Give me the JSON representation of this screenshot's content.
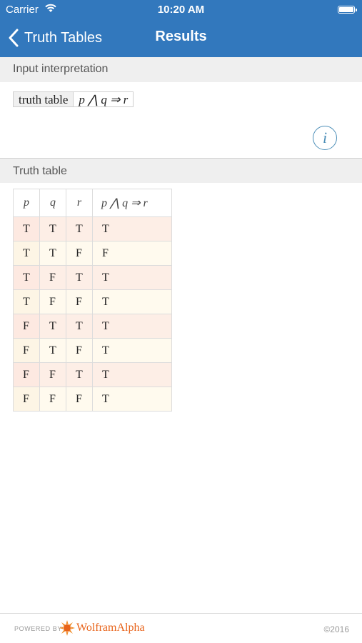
{
  "status": {
    "carrier": "Carrier",
    "time": "10:20 AM"
  },
  "nav": {
    "back_label": "Truth Tables",
    "title": "Results"
  },
  "input_section": {
    "header": "Input interpretation",
    "cell_label": "truth table",
    "cell_expression": "p ⋀ q ⇒ r",
    "info_symbol": "i"
  },
  "truth_table": {
    "header": "Truth table",
    "columns": [
      "p",
      "q",
      "r",
      "p ⋀ q ⇒ r"
    ],
    "rows": [
      [
        "T",
        "T",
        "T",
        "T"
      ],
      [
        "T",
        "T",
        "F",
        "F"
      ],
      [
        "T",
        "F",
        "T",
        "T"
      ],
      [
        "T",
        "F",
        "F",
        "T"
      ],
      [
        "F",
        "T",
        "T",
        "T"
      ],
      [
        "F",
        "T",
        "F",
        "T"
      ],
      [
        "F",
        "F",
        "T",
        "T"
      ],
      [
        "F",
        "F",
        "F",
        "T"
      ]
    ]
  },
  "footer": {
    "powered_by": "POWERED BY",
    "brand": "WolframAlpha",
    "copyright": "©2016"
  },
  "colors": {
    "nav_blue": "#3278bd",
    "brand_orange": "#e8631a",
    "info_blue": "#4d8fb8"
  },
  "icons": {
    "wifi": "wifi-icon",
    "battery": "battery-icon",
    "back": "chevron-left-icon",
    "info": "info-icon",
    "logo": "wolfram-spikey-icon"
  }
}
